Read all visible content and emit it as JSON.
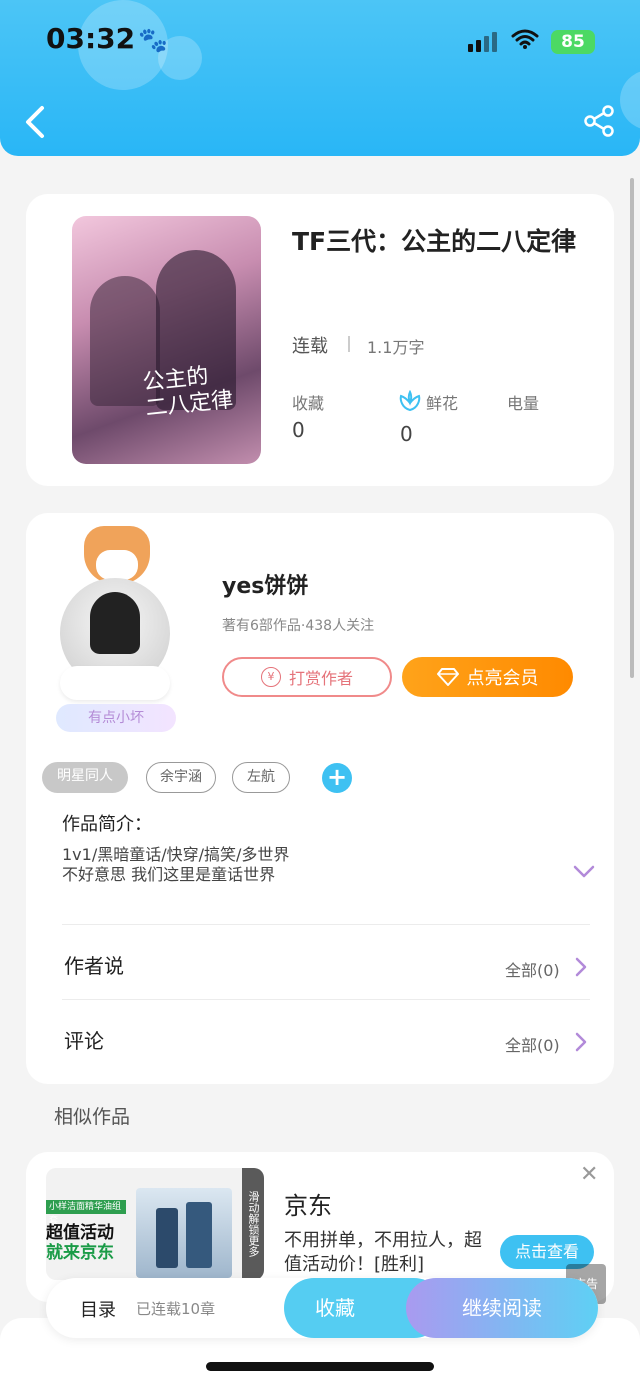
{
  "status_bar": {
    "time": "03:32",
    "battery": "85"
  },
  "book": {
    "title": "TF三代：公主的二八定律",
    "cover_text": "公主的\n二八定律",
    "status": "连载",
    "word_count": "1.1万字",
    "stats": [
      {
        "label": "收藏",
        "value": "0"
      },
      {
        "label": "鲜花",
        "value": "0"
      },
      {
        "label": "电量",
        "value": ""
      }
    ]
  },
  "author": {
    "name": "yes饼饼",
    "meta": "著有6部作品·438人关注",
    "badge": "有点小坏",
    "tip_label": "打赏作者",
    "vip_label": "点亮会员"
  },
  "tags": [
    "明星同人",
    "余宇涵",
    "左航"
  ],
  "intro": {
    "title": "作品简介：",
    "lines": [
      "1v1/黑暗童话/快穿/搞笑/多世界",
      "不好意思 我们这里是童话世界"
    ]
  },
  "rows": [
    {
      "title": "作者说",
      "right": "全部(0)"
    },
    {
      "title": "评论",
      "right": "全部(0)"
    }
  ],
  "similar": {
    "title": "相似作品",
    "ad": {
      "title": "京东",
      "desc": "不用拼单，不用拉人，超值活动价！[胜利]",
      "button": "点击查看",
      "img_line1": "超值活动",
      "img_line2": "就来京东",
      "img_top": "小样洁面精华油组套",
      "img_side": "滑动解锁更多",
      "ad_tag": "广告"
    }
  },
  "bottom_bar": {
    "toc": "目录",
    "chapters": "已连载10章",
    "fav": "收藏",
    "read": "继续阅读"
  },
  "colors": {
    "header": "#29b6f6",
    "accent": "#3ec1f2",
    "vip": "#ff8a00",
    "tip": "#e5737a"
  }
}
